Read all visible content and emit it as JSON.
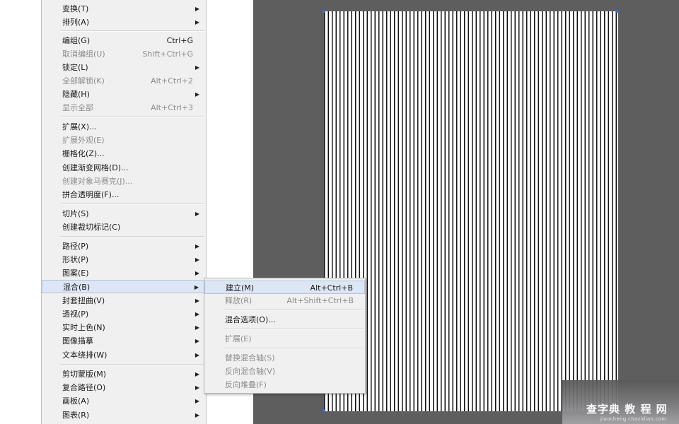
{
  "object_menu": {
    "items": [
      {
        "label": "变换(T)",
        "shortcut": "",
        "submenu": true,
        "disabled": false
      },
      {
        "label": "排列(A)",
        "shortcut": "",
        "submenu": true,
        "disabled": false
      },
      {
        "label": "编组(G)",
        "shortcut": "Ctrl+G",
        "submenu": false,
        "disabled": false
      },
      {
        "label": "取消编组(U)",
        "shortcut": "Shift+Ctrl+G",
        "submenu": false,
        "disabled": true
      },
      {
        "label": "锁定(L)",
        "shortcut": "",
        "submenu": true,
        "disabled": false
      },
      {
        "label": "全部解锁(K)",
        "shortcut": "Alt+Ctrl+2",
        "submenu": false,
        "disabled": true
      },
      {
        "label": "隐藏(H)",
        "shortcut": "",
        "submenu": true,
        "disabled": false
      },
      {
        "label": "显示全部",
        "shortcut": "Alt+Ctrl+3",
        "submenu": false,
        "disabled": true
      },
      {
        "label": "扩展(X)...",
        "shortcut": "",
        "submenu": false,
        "disabled": false
      },
      {
        "label": "扩展外观(E)",
        "shortcut": "",
        "submenu": false,
        "disabled": true
      },
      {
        "label": "栅格化(Z)...",
        "shortcut": "",
        "submenu": false,
        "disabled": false
      },
      {
        "label": "创建渐变网格(D)...",
        "shortcut": "",
        "submenu": false,
        "disabled": false
      },
      {
        "label": "创建对象马赛克(J)...",
        "shortcut": "",
        "submenu": false,
        "disabled": true
      },
      {
        "label": "拼合透明度(F)...",
        "shortcut": "",
        "submenu": false,
        "disabled": false
      },
      {
        "label": "切片(S)",
        "shortcut": "",
        "submenu": true,
        "disabled": false
      },
      {
        "label": "创建裁切标记(C)",
        "shortcut": "",
        "submenu": false,
        "disabled": false
      },
      {
        "label": "路径(P)",
        "shortcut": "",
        "submenu": true,
        "disabled": false
      },
      {
        "label": "形状(P)",
        "shortcut": "",
        "submenu": true,
        "disabled": false
      },
      {
        "label": "图案(E)",
        "shortcut": "",
        "submenu": true,
        "disabled": false
      },
      {
        "label": "混合(B)",
        "shortcut": "",
        "submenu": true,
        "disabled": false,
        "highlighted": true
      },
      {
        "label": "封套扭曲(V)",
        "shortcut": "",
        "submenu": true,
        "disabled": false
      },
      {
        "label": "透视(P)",
        "shortcut": "",
        "submenu": true,
        "disabled": false
      },
      {
        "label": "实时上色(N)",
        "shortcut": "",
        "submenu": true,
        "disabled": false
      },
      {
        "label": "图像描摹",
        "shortcut": "",
        "submenu": true,
        "disabled": false
      },
      {
        "label": "文本绕排(W)",
        "shortcut": "",
        "submenu": true,
        "disabled": false
      },
      {
        "label": "剪切蒙版(M)",
        "shortcut": "",
        "submenu": true,
        "disabled": false
      },
      {
        "label": "复合路径(O)",
        "shortcut": "",
        "submenu": true,
        "disabled": false
      },
      {
        "label": "画板(A)",
        "shortcut": "",
        "submenu": true,
        "disabled": false
      },
      {
        "label": "图表(R)",
        "shortcut": "",
        "submenu": true,
        "disabled": false
      }
    ]
  },
  "blend_submenu": {
    "items": [
      {
        "label": "建立(M)",
        "shortcut": "Alt+Ctrl+B",
        "disabled": false,
        "highlighted": true
      },
      {
        "label": "释放(R)",
        "shortcut": "Alt+Shift+Ctrl+B",
        "disabled": true
      },
      {
        "label": "混合选项(O)...",
        "shortcut": "",
        "disabled": false
      },
      {
        "label": "扩展(E)",
        "shortcut": "",
        "disabled": true
      },
      {
        "label": "替换混合轴(S)",
        "shortcut": "",
        "disabled": true
      },
      {
        "label": "反向混合轴(V)",
        "shortcut": "",
        "disabled": true
      },
      {
        "label": "反向堆叠(F)",
        "shortcut": "",
        "disabled": true
      }
    ]
  },
  "icons": {
    "submenu_arrow": "triangle-right-icon"
  },
  "colors": {
    "menu_bg": "#f0f0f0",
    "highlight_bg": "#dce6f4",
    "highlight_border": "#aec4e6",
    "canvas_bg": "#5e5e5e",
    "stripe": "#111111",
    "anchor": "#3a6ad8"
  },
  "watermark": {
    "title": "查字典 教 程 网",
    "subtitle": "jiaocheng.chazidian.com"
  }
}
